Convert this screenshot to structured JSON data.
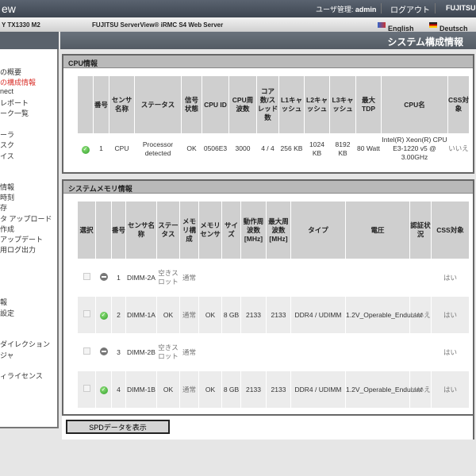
{
  "top": {
    "app_title": "ew",
    "user_label": "ユーザ管理:",
    "user_name": "admin",
    "logout": "ログアウト",
    "logo": "FUJITSU"
  },
  "bar2": {
    "model": "Y TX1330 M2",
    "product": "FUJITSU ServerView® iRMC S4 Web Server",
    "lang_en": "English",
    "lang_de": "Deutsch"
  },
  "page_title": "システム構成情報",
  "sidebar": {
    "items": [
      {
        "label": "の概要",
        "active": false
      },
      {
        "label": "の構成情報",
        "active": true
      },
      {
        "label": "nect"
      },
      {
        "label": "レポート"
      },
      {
        "label": "ーク一覧"
      },
      {
        "label": "ーラ"
      },
      {
        "label": "スク"
      },
      {
        "label": "イス"
      },
      {
        "label": "情報"
      },
      {
        "label": "時刻"
      },
      {
        "label": "存"
      },
      {
        "label": "タ アップロード"
      },
      {
        "label": "作成"
      },
      {
        "label": "アップデート"
      },
      {
        "label": "用ログ出力"
      },
      {
        "label": "報"
      },
      {
        "label": "設定"
      },
      {
        "label": "ダイレクション"
      },
      {
        "label": "ジャ"
      },
      {
        "label": "ィライセンス"
      }
    ]
  },
  "cpu": {
    "title": "CPU情報",
    "headers": [
      "",
      "番号",
      "センサ名称",
      "ステータス",
      "信号状態",
      "CPU ID",
      "CPU周波数",
      "コア数/スレッド数",
      "L1キャッシュ",
      "L2キャッシュ",
      "L3キャッシュ",
      "最大TDP",
      "CPU名",
      "CSS対象"
    ],
    "rows": [
      {
        "status_icon": "check-ok",
        "cells": [
          "1",
          "CPU",
          "Processor detected",
          "OK",
          "0506E3",
          "3000",
          "4 / 4",
          "256 KB",
          "1024 KB",
          "8192 KB",
          "80 Watt",
          "Intel(R) Xeon(R) CPU E3-1220 v5 @ 3.00GHz",
          "いいえ"
        ]
      }
    ]
  },
  "memory": {
    "title": "システムメモリ情報",
    "headers": [
      "選択",
      "",
      "番号",
      "センサ名称",
      "ステータス",
      "メモリ構成",
      "メモリセンサ",
      "サイズ",
      "動作周波数 [MHz]",
      "最大周波数 [MHz]",
      "タイプ",
      "電圧",
      "認証状況",
      "CSS対象"
    ],
    "rows": [
      {
        "status_icon": "empty",
        "cells": [
          "1",
          "DIMM-2A",
          "空きスロット",
          "通常",
          "",
          "",
          "",
          "",
          "",
          "",
          "",
          "はい"
        ]
      },
      {
        "status_icon": "check-ok",
        "cells": [
          "2",
          "DIMM-1A",
          "OK",
          "通常",
          "OK",
          "8 GB",
          "2133",
          "2133",
          "DDR4 / UDIMM",
          "1.2V_Operable_Endurant",
          "いいえ",
          "はい"
        ]
      },
      {
        "status_icon": "empty",
        "cells": [
          "3",
          "DIMM-2B",
          "空きスロット",
          "通常",
          "",
          "",
          "",
          "",
          "",
          "",
          "",
          "はい"
        ]
      },
      {
        "status_icon": "check-ok",
        "cells": [
          "4",
          "DIMM-1B",
          "OK",
          "通常",
          "OK",
          "8 GB",
          "2133",
          "2133",
          "DDR4 / UDIMM",
          "1.2V_Operable_Endurant",
          "いいえ",
          "はい"
        ]
      }
    ]
  },
  "spd_button": "SPDデータを表示"
}
